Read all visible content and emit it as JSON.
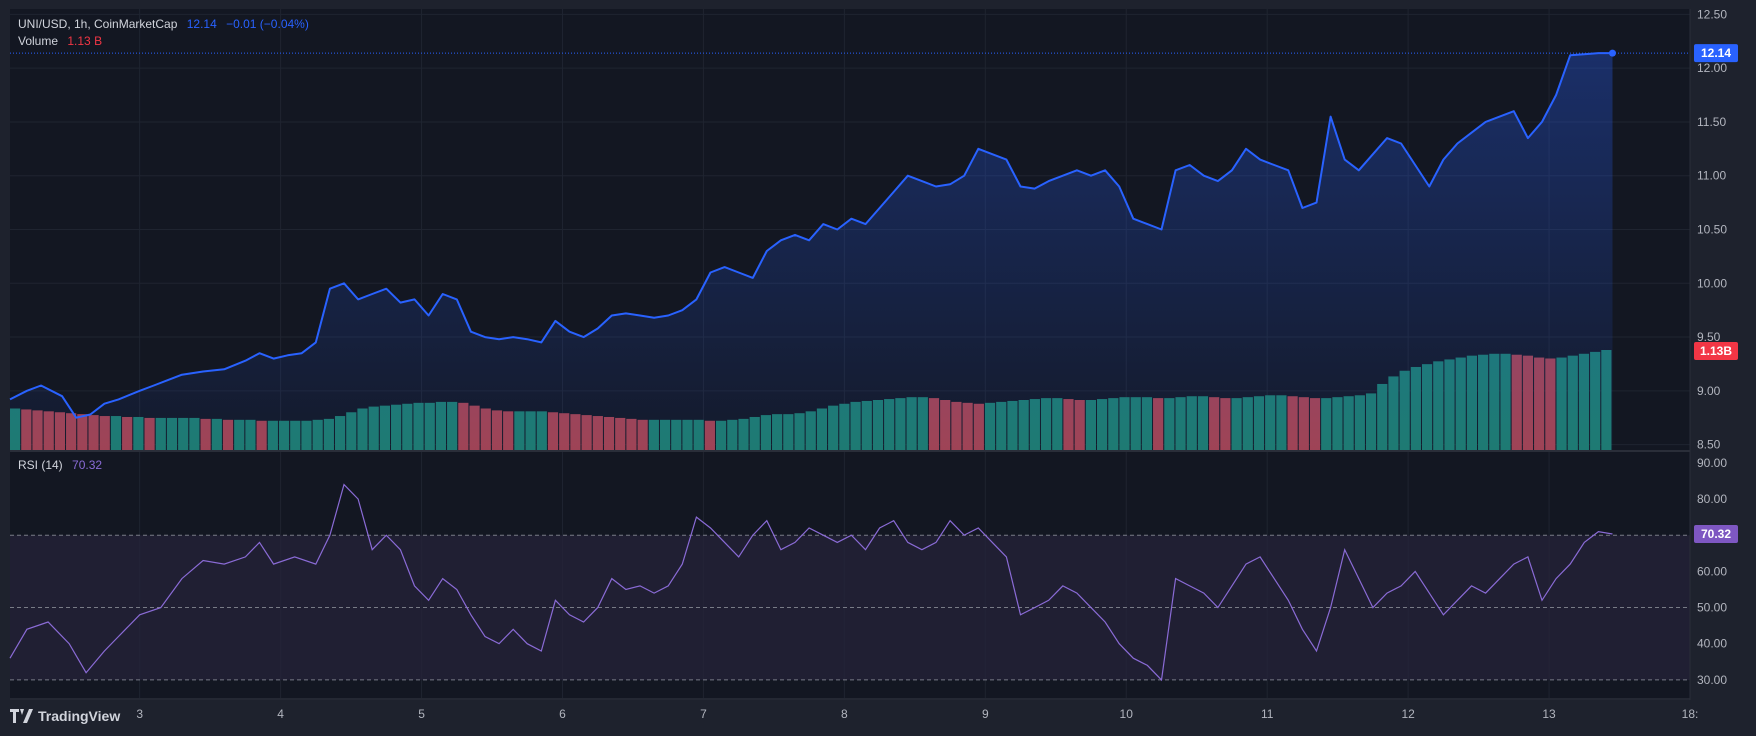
{
  "header": {
    "symbol": "UNI/USD, 1h, CoinMarketCap",
    "last_price": "12.14",
    "change": "−0.01 (−0.04%)",
    "volume_label": "Volume",
    "volume_value": "1.13 B"
  },
  "rsi_header": {
    "label": "RSI (14)",
    "value": "70.32"
  },
  "brand": {
    "name": "TradingView"
  },
  "colors": {
    "background": "#131722",
    "frame": "#1e222d",
    "price_line": "#2962ff",
    "volume_up": "#1d7b6d",
    "volume_down": "#a3424f",
    "rsi_line": "#8a6bd6",
    "rsi_band": "#262339",
    "price_badge": "#2962ff",
    "volume_badge": "#f23645",
    "rsi_badge": "#7e57c2",
    "text": "#d1d4dc",
    "positive": "#2962ff",
    "negative": "#f23645"
  },
  "chart_data": [
    {
      "type": "area",
      "pane": "price",
      "x_ticks": [
        "3",
        "4",
        "5",
        "6",
        "7",
        "8",
        "9",
        "10",
        "11",
        "12",
        "13",
        "18:"
      ],
      "y_ticks": [
        "12.50",
        "12.00",
        "11.50",
        "11.00",
        "10.50",
        "10.00",
        "9.50",
        "9.00",
        "8.50"
      ],
      "ylim": [
        8.45,
        12.55
      ],
      "x_range": [
        2.08,
        14.0
      ],
      "last_value_label": "12.14",
      "series": [
        {
          "x": [
            2.08,
            2.2,
            2.3,
            2.45,
            2.55,
            2.65,
            2.75,
            2.85,
            3.0,
            3.1,
            3.2,
            3.3,
            3.45,
            3.6,
            3.75,
            3.85,
            3.95,
            4.05,
            4.15,
            4.25,
            4.35,
            4.45,
            4.55,
            4.65,
            4.75,
            4.85,
            4.95,
            5.05,
            5.15,
            5.25,
            5.35,
            5.45,
            5.55,
            5.65,
            5.75,
            5.85,
            5.95,
            6.05,
            6.15,
            6.25,
            6.35,
            6.45,
            6.55,
            6.65,
            6.75,
            6.85,
            6.95,
            7.05,
            7.15,
            7.25,
            7.35,
            7.45,
            7.55,
            7.65,
            7.75,
            7.85,
            7.95,
            8.05,
            8.15,
            8.25,
            8.35,
            8.45,
            8.55,
            8.65,
            8.75,
            8.85,
            8.95,
            9.05,
            9.15,
            9.25,
            9.35,
            9.45,
            9.55,
            9.65,
            9.75,
            9.85,
            9.95,
            10.05,
            10.15,
            10.25,
            10.35,
            10.45,
            10.55,
            10.65,
            10.75,
            10.85,
            10.95,
            11.05,
            11.15,
            11.25,
            11.35,
            11.45,
            11.55,
            11.65,
            11.75,
            11.85,
            11.95,
            12.05,
            12.15,
            12.25,
            12.35,
            12.45,
            12.55,
            12.65,
            12.75,
            12.85,
            12.95,
            13.05,
            13.15,
            13.25,
            13.35,
            13.45
          ],
          "values": [
            8.92,
            9.0,
            9.05,
            8.95,
            8.75,
            8.78,
            8.88,
            8.92,
            9.0,
            9.05,
            9.1,
            9.15,
            9.18,
            9.2,
            9.28,
            9.35,
            9.3,
            9.33,
            9.35,
            9.45,
            9.95,
            10.0,
            9.85,
            9.9,
            9.95,
            9.82,
            9.85,
            9.7,
            9.9,
            9.85,
            9.55,
            9.5,
            9.48,
            9.5,
            9.48,
            9.45,
            9.65,
            9.55,
            9.5,
            9.58,
            9.7,
            9.72,
            9.7,
            9.68,
            9.7,
            9.75,
            9.85,
            10.1,
            10.15,
            10.1,
            10.05,
            10.3,
            10.4,
            10.45,
            10.4,
            10.55,
            10.5,
            10.6,
            10.55,
            10.7,
            10.85,
            11.0,
            10.95,
            10.9,
            10.92,
            11.0,
            11.25,
            11.2,
            11.15,
            10.9,
            10.88,
            10.95,
            11.0,
            11.05,
            11.0,
            11.05,
            10.9,
            10.6,
            10.55,
            10.5,
            11.05,
            11.1,
            11.0,
            10.95,
            11.05,
            11.25,
            11.15,
            11.1,
            11.05,
            10.7,
            10.75,
            11.55,
            11.15,
            11.05,
            11.2,
            11.35,
            11.3,
            11.1,
            10.9,
            11.15,
            11.3,
            11.4,
            11.5,
            11.55,
            11.6,
            11.35,
            11.5,
            11.75,
            12.12,
            12.13,
            12.14,
            12.14
          ]
        }
      ]
    },
    {
      "type": "bar",
      "pane": "volume",
      "last_value_label": "1.13B",
      "series": [
        {
          "name": "Volume",
          "levels": [
            0.44,
            0.43,
            0.42,
            0.41,
            0.4,
            0.39,
            0.38,
            0.37,
            0.36,
            0.36,
            0.35,
            0.35,
            0.34,
            0.34,
            0.34,
            0.34,
            0.34,
            0.33,
            0.33,
            0.32,
            0.32,
            0.32,
            0.31,
            0.31,
            0.31,
            0.31,
            0.31,
            0.32,
            0.33,
            0.36,
            0.4,
            0.44,
            0.46,
            0.47,
            0.48,
            0.49,
            0.5,
            0.5,
            0.51,
            0.51,
            0.5,
            0.47,
            0.44,
            0.42,
            0.41,
            0.41,
            0.41,
            0.41,
            0.4,
            0.39,
            0.38,
            0.37,
            0.36,
            0.35,
            0.34,
            0.33,
            0.32,
            0.32,
            0.32,
            0.32,
            0.32,
            0.32,
            0.31,
            0.31,
            0.32,
            0.33,
            0.35,
            0.37,
            0.38,
            0.38,
            0.39,
            0.41,
            0.44,
            0.47,
            0.49,
            0.51,
            0.52,
            0.53,
            0.54,
            0.55,
            0.56,
            0.56,
            0.55,
            0.53,
            0.51,
            0.5,
            0.49,
            0.5,
            0.51,
            0.52,
            0.53,
            0.54,
            0.55,
            0.55,
            0.54,
            0.53,
            0.53,
            0.54,
            0.55,
            0.56,
            0.56,
            0.56,
            0.55,
            0.55,
            0.56,
            0.57,
            0.57,
            0.56,
            0.55,
            0.55,
            0.56,
            0.57,
            0.58,
            0.58,
            0.57,
            0.56,
            0.55,
            0.55,
            0.56,
            0.57,
            0.58,
            0.6,
            0.7,
            0.78,
            0.84,
            0.88,
            0.91,
            0.94,
            0.96,
            0.98,
            1.0,
            1.01,
            1.02,
            1.02,
            1.01,
            1.0,
            0.98,
            0.97,
            0.98,
            1.0,
            1.02,
            1.04,
            1.06
          ]
        }
      ]
    },
    {
      "type": "line",
      "pane": "rsi",
      "y_ticks": [
        "90.00",
        "80.00",
        "70.00",
        "60.00",
        "50.00",
        "40.00",
        "30.00"
      ],
      "ylim": [
        25,
        93
      ],
      "bands": [
        30,
        50,
        70
      ],
      "last_value_label": "70.32",
      "series": [
        {
          "name": "RSI (14)",
          "x": [
            2.08,
            2.2,
            2.35,
            2.5,
            2.62,
            2.75,
            2.85,
            3.0,
            3.15,
            3.3,
            3.45,
            3.6,
            3.75,
            3.85,
            3.95,
            4.1,
            4.25,
            4.35,
            4.45,
            4.55,
            4.65,
            4.75,
            4.85,
            4.95,
            5.05,
            5.15,
            5.25,
            5.35,
            5.45,
            5.55,
            5.65,
            5.75,
            5.85,
            5.95,
            6.05,
            6.15,
            6.25,
            6.35,
            6.45,
            6.55,
            6.65,
            6.75,
            6.85,
            6.95,
            7.05,
            7.15,
            7.25,
            7.35,
            7.45,
            7.55,
            7.65,
            7.75,
            7.85,
            7.95,
            8.05,
            8.15,
            8.25,
            8.35,
            8.45,
            8.55,
            8.65,
            8.75,
            8.85,
            8.95,
            9.05,
            9.15,
            9.25,
            9.35,
            9.45,
            9.55,
            9.65,
            9.75,
            9.85,
            9.95,
            10.05,
            10.15,
            10.25,
            10.35,
            10.45,
            10.55,
            10.65,
            10.75,
            10.85,
            10.95,
            11.05,
            11.15,
            11.25,
            11.35,
            11.45,
            11.55,
            11.65,
            11.75,
            11.85,
            11.95,
            12.05,
            12.15,
            12.25,
            12.35,
            12.45,
            12.55,
            12.65,
            12.75,
            12.85,
            12.95,
            13.05,
            13.15,
            13.25,
            13.35,
            13.45
          ],
          "values": [
            36,
            44,
            46,
            40,
            32,
            38,
            42,
            48,
            50,
            58,
            63,
            62,
            64,
            68,
            62,
            64,
            62,
            70,
            84,
            80,
            66,
            70,
            66,
            56,
            52,
            58,
            55,
            48,
            42,
            40,
            44,
            40,
            38,
            52,
            48,
            46,
            50,
            58,
            55,
            56,
            54,
            56,
            62,
            75,
            72,
            68,
            64,
            70,
            74,
            66,
            68,
            72,
            70,
            68,
            70,
            66,
            72,
            74,
            68,
            66,
            68,
            74,
            70,
            72,
            68,
            64,
            48,
            50,
            52,
            56,
            54,
            50,
            46,
            40,
            36,
            34,
            30,
            58,
            56,
            54,
            50,
            56,
            62,
            64,
            58,
            52,
            44,
            38,
            50,
            66,
            58,
            50,
            54,
            56,
            60,
            54,
            48,
            52,
            56,
            54,
            58,
            62,
            64,
            52,
            58,
            62,
            68,
            71,
            70.32
          ]
        }
      ]
    }
  ]
}
